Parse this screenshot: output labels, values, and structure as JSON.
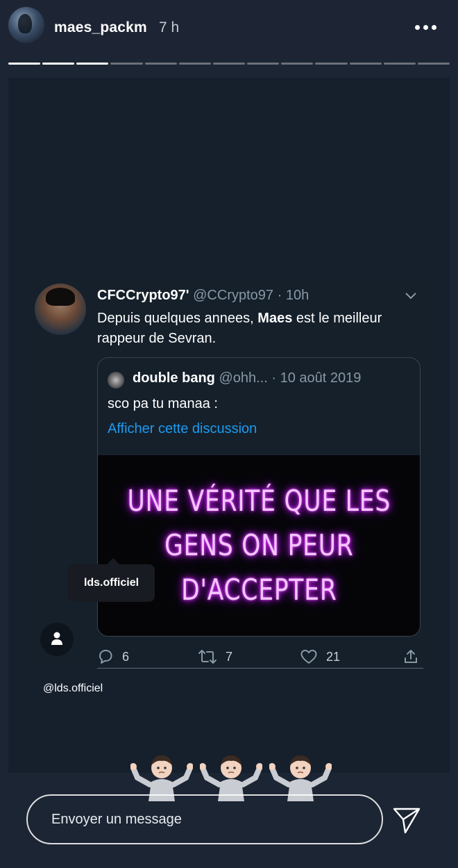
{
  "story": {
    "username": "maes_packm",
    "time_ago": "7 h",
    "progress_total": 13,
    "progress_done": 3
  },
  "tweet": {
    "display_name": "CFCCrypto97'",
    "handle": "@CCrypto97",
    "separator": "·",
    "time": "10h",
    "text_before": "Depuis quelques annees, ",
    "text_bold": "Maes",
    "text_after": " est le meilleur rappeur de Sevran.",
    "quote": {
      "display_name": "double bang",
      "handle": "@ohh...",
      "separator": "·",
      "date": "10 août 2019",
      "text": "sco pa tu manaa :",
      "link": "Afficher cette discussion",
      "media_lines": [
        "UNE VÉRITÉ QUE LES",
        "GENS ON PEUR",
        "D'ACCEPTER"
      ]
    },
    "counts": {
      "replies": "6",
      "retweets": "7",
      "likes": "21"
    }
  },
  "overlay": {
    "tag_label": "lds.officiel",
    "mention": "@lds.officiel",
    "emoji": [
      "🤷🏻‍♂️",
      "🤷🏻‍♂️",
      "🤷🏻‍♂️"
    ]
  },
  "reply": {
    "placeholder": "Envoyer un message"
  },
  "colors": {
    "background": "#1c2533",
    "tweet_bg": "#15202b",
    "link": "#1d9bf0",
    "muted": "#8899a6",
    "neon": "#e64cff"
  }
}
